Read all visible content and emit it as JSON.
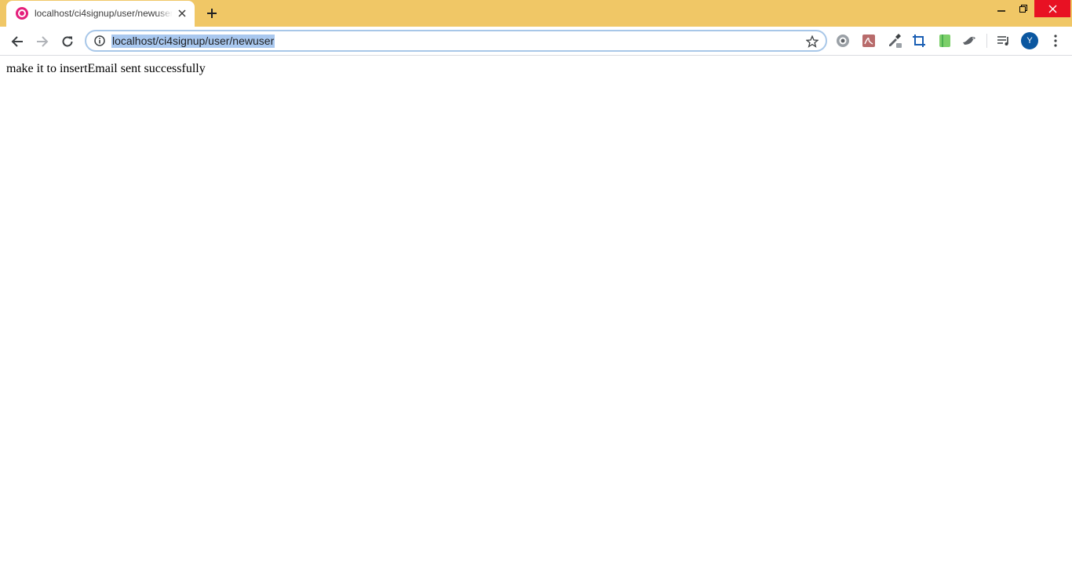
{
  "browser": {
    "tab": {
      "title": "localhost/ci4signup/user/newuser",
      "favicon": "wamp-favicon-icon"
    },
    "address_bar": {
      "url": "localhost/ci4signup/user/newuser",
      "selected": true
    },
    "profile_initial": "Y",
    "colors": {
      "title_bar": "#f0c766",
      "close_button": "#e81123",
      "url_selection": "#a9c8ef",
      "avatar": "#0b57a0"
    },
    "extensions": [
      "camera-icon",
      "pdf-icon",
      "eyedropper-icon",
      "crop-icon",
      "green-extension-icon",
      "bird-icon",
      "media-control-icon"
    ]
  },
  "page": {
    "message": "make it to insertEmail sent successfully"
  }
}
